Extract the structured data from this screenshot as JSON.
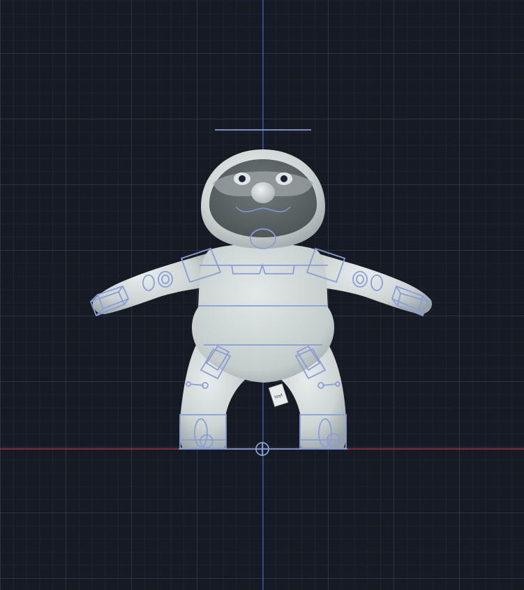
{
  "viewport": {
    "view": "Front",
    "colors": {
      "background": "#151a23",
      "grid_minor": "#283041",
      "grid_major": "#323c50",
      "axis_vertical": "#3f6fd8",
      "axis_horizontal": "#c0334f",
      "rig_controls": "#8a9ed6",
      "model_surface": "#cfd6d6"
    }
  },
  "model": {
    "name": "sloth-character",
    "belly_tag_text": "toyt"
  },
  "rig": {
    "controls": [
      "head-control",
      "neck-control",
      "left-shoulder-control",
      "right-shoulder-control",
      "chest-control",
      "left-elbow-control",
      "right-elbow-control",
      "left-wrist-control",
      "right-wrist-control",
      "torso-control",
      "hip-control",
      "left-hip-joint-control",
      "right-hip-joint-control",
      "left-knee-pole-control",
      "right-knee-pole-control",
      "left-foot-control",
      "right-foot-control",
      "root-control"
    ]
  }
}
